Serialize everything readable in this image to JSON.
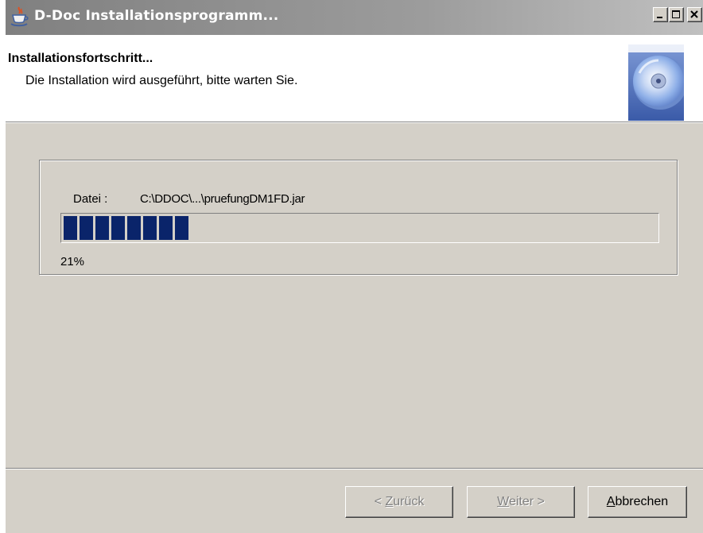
{
  "window": {
    "title": "D-Doc Installationsprogramm...",
    "icon": "java-cup-icon",
    "controls": [
      "minimize-icon",
      "maximize-icon",
      "close-icon"
    ]
  },
  "header": {
    "title": "Installationsfortschritt...",
    "subtitle": "Die Installation wird ausgeführt, bitte warten Sie.",
    "icon": "cd-disc-icon"
  },
  "progress": {
    "file_label": "Datei :",
    "file_path": "C:\\DDOC\\...\\pruefungDM1FD.jar",
    "percent_text": "21%",
    "value": 0.21,
    "blocks_filled": 8,
    "fill_color": "#0a246a"
  },
  "buttons": {
    "back": {
      "prefix": "< ",
      "mnemonic": "Z",
      "rest": "urück",
      "enabled": false
    },
    "next": {
      "prefix": "",
      "mnemonic": "W",
      "rest": "eiter >",
      "enabled": false
    },
    "cancel": {
      "prefix": "",
      "mnemonic": "A",
      "rest": "bbrechen",
      "enabled": true
    }
  },
  "colors": {
    "face": "#d4d0c8",
    "title_gradient_start": "#808080",
    "title_gradient_end": "#c0c0c0",
    "disabled_text": "#808080"
  }
}
